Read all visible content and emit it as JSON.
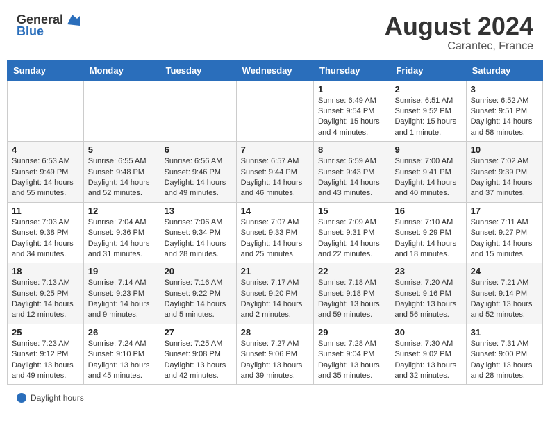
{
  "header": {
    "logo_line1": "General",
    "logo_line2": "Blue",
    "month": "August 2024",
    "location": "Carantec, France"
  },
  "days_of_week": [
    "Sunday",
    "Monday",
    "Tuesday",
    "Wednesday",
    "Thursday",
    "Friday",
    "Saturday"
  ],
  "weeks": [
    [
      {
        "day": "",
        "info": ""
      },
      {
        "day": "",
        "info": ""
      },
      {
        "day": "",
        "info": ""
      },
      {
        "day": "",
        "info": ""
      },
      {
        "day": "1",
        "info": "Sunrise: 6:49 AM\nSunset: 9:54 PM\nDaylight: 15 hours\nand 4 minutes."
      },
      {
        "day": "2",
        "info": "Sunrise: 6:51 AM\nSunset: 9:52 PM\nDaylight: 15 hours\nand 1 minute."
      },
      {
        "day": "3",
        "info": "Sunrise: 6:52 AM\nSunset: 9:51 PM\nDaylight: 14 hours\nand 58 minutes."
      }
    ],
    [
      {
        "day": "4",
        "info": "Sunrise: 6:53 AM\nSunset: 9:49 PM\nDaylight: 14 hours\nand 55 minutes."
      },
      {
        "day": "5",
        "info": "Sunrise: 6:55 AM\nSunset: 9:48 PM\nDaylight: 14 hours\nand 52 minutes."
      },
      {
        "day": "6",
        "info": "Sunrise: 6:56 AM\nSunset: 9:46 PM\nDaylight: 14 hours\nand 49 minutes."
      },
      {
        "day": "7",
        "info": "Sunrise: 6:57 AM\nSunset: 9:44 PM\nDaylight: 14 hours\nand 46 minutes."
      },
      {
        "day": "8",
        "info": "Sunrise: 6:59 AM\nSunset: 9:43 PM\nDaylight: 14 hours\nand 43 minutes."
      },
      {
        "day": "9",
        "info": "Sunrise: 7:00 AM\nSunset: 9:41 PM\nDaylight: 14 hours\nand 40 minutes."
      },
      {
        "day": "10",
        "info": "Sunrise: 7:02 AM\nSunset: 9:39 PM\nDaylight: 14 hours\nand 37 minutes."
      }
    ],
    [
      {
        "day": "11",
        "info": "Sunrise: 7:03 AM\nSunset: 9:38 PM\nDaylight: 14 hours\nand 34 minutes."
      },
      {
        "day": "12",
        "info": "Sunrise: 7:04 AM\nSunset: 9:36 PM\nDaylight: 14 hours\nand 31 minutes."
      },
      {
        "day": "13",
        "info": "Sunrise: 7:06 AM\nSunset: 9:34 PM\nDaylight: 14 hours\nand 28 minutes."
      },
      {
        "day": "14",
        "info": "Sunrise: 7:07 AM\nSunset: 9:33 PM\nDaylight: 14 hours\nand 25 minutes."
      },
      {
        "day": "15",
        "info": "Sunrise: 7:09 AM\nSunset: 9:31 PM\nDaylight: 14 hours\nand 22 minutes."
      },
      {
        "day": "16",
        "info": "Sunrise: 7:10 AM\nSunset: 9:29 PM\nDaylight: 14 hours\nand 18 minutes."
      },
      {
        "day": "17",
        "info": "Sunrise: 7:11 AM\nSunset: 9:27 PM\nDaylight: 14 hours\nand 15 minutes."
      }
    ],
    [
      {
        "day": "18",
        "info": "Sunrise: 7:13 AM\nSunset: 9:25 PM\nDaylight: 14 hours\nand 12 minutes."
      },
      {
        "day": "19",
        "info": "Sunrise: 7:14 AM\nSunset: 9:23 PM\nDaylight: 14 hours\nand 9 minutes."
      },
      {
        "day": "20",
        "info": "Sunrise: 7:16 AM\nSunset: 9:22 PM\nDaylight: 14 hours\nand 5 minutes."
      },
      {
        "day": "21",
        "info": "Sunrise: 7:17 AM\nSunset: 9:20 PM\nDaylight: 14 hours\nand 2 minutes."
      },
      {
        "day": "22",
        "info": "Sunrise: 7:18 AM\nSunset: 9:18 PM\nDaylight: 13 hours\nand 59 minutes."
      },
      {
        "day": "23",
        "info": "Sunrise: 7:20 AM\nSunset: 9:16 PM\nDaylight: 13 hours\nand 56 minutes."
      },
      {
        "day": "24",
        "info": "Sunrise: 7:21 AM\nSunset: 9:14 PM\nDaylight: 13 hours\nand 52 minutes."
      }
    ],
    [
      {
        "day": "25",
        "info": "Sunrise: 7:23 AM\nSunset: 9:12 PM\nDaylight: 13 hours\nand 49 minutes."
      },
      {
        "day": "26",
        "info": "Sunrise: 7:24 AM\nSunset: 9:10 PM\nDaylight: 13 hours\nand 45 minutes."
      },
      {
        "day": "27",
        "info": "Sunrise: 7:25 AM\nSunset: 9:08 PM\nDaylight: 13 hours\nand 42 minutes."
      },
      {
        "day": "28",
        "info": "Sunrise: 7:27 AM\nSunset: 9:06 PM\nDaylight: 13 hours\nand 39 minutes."
      },
      {
        "day": "29",
        "info": "Sunrise: 7:28 AM\nSunset: 9:04 PM\nDaylight: 13 hours\nand 35 minutes."
      },
      {
        "day": "30",
        "info": "Sunrise: 7:30 AM\nSunset: 9:02 PM\nDaylight: 13 hours\nand 32 minutes."
      },
      {
        "day": "31",
        "info": "Sunrise: 7:31 AM\nSunset: 9:00 PM\nDaylight: 13 hours\nand 28 minutes."
      }
    ]
  ],
  "footer": {
    "label": "Daylight hours"
  }
}
